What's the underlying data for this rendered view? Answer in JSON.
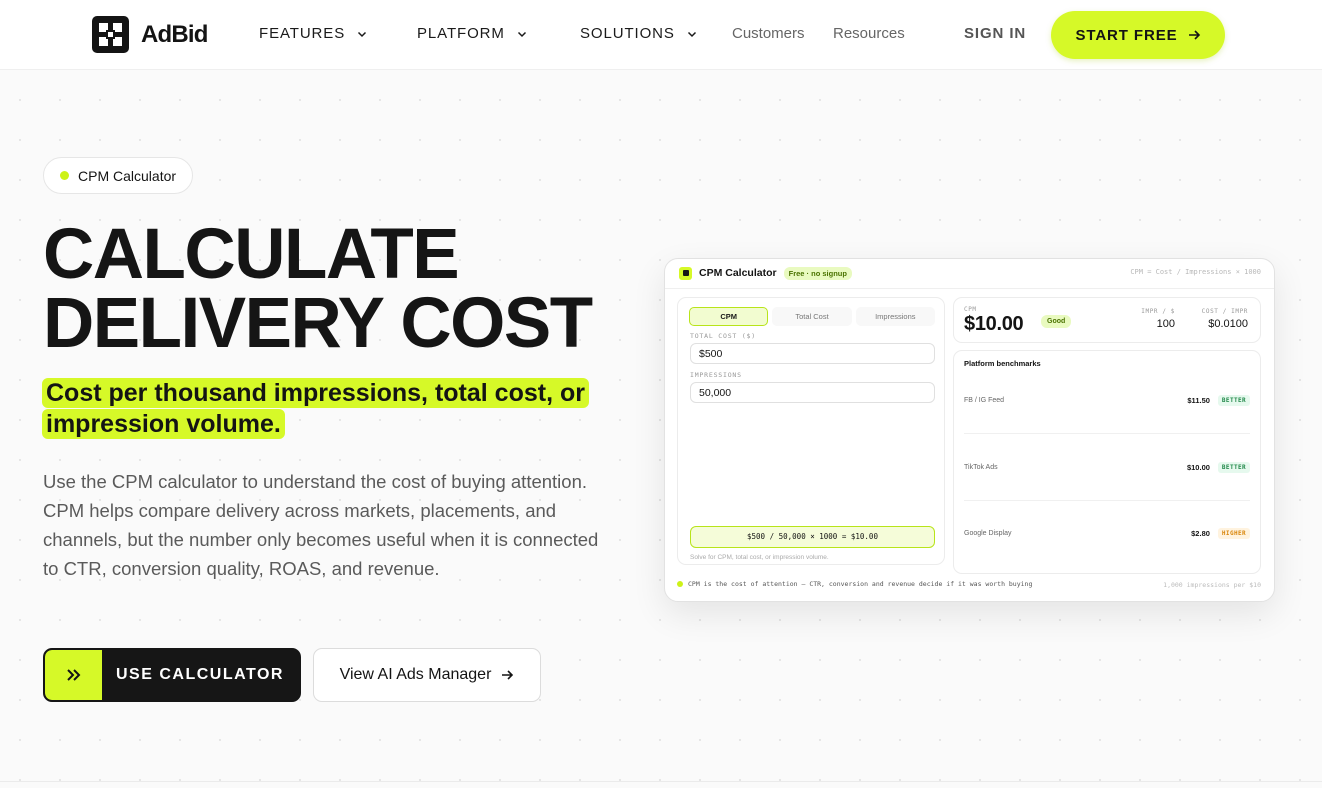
{
  "nav": {
    "brand": "AdBid",
    "items": [
      {
        "label": "FEATURES",
        "dropdown": true
      },
      {
        "label": "PLATFORM",
        "dropdown": true
      },
      {
        "label": "SOLUTIONS",
        "dropdown": true
      },
      {
        "label": "Customers",
        "dropdown": false
      },
      {
        "label": "Resources",
        "dropdown": false
      }
    ],
    "sign_in": "SIGN IN",
    "cta": "START FREE"
  },
  "hero": {
    "pill": "CPM Calculator",
    "title_line1": "CALCULATE",
    "title_line2": "DELIVERY COST",
    "highlight_line1": "Cost per thousand impressions, total cost, or",
    "highlight_line2": "impression volume.",
    "description": "Use the CPM calculator to understand the cost of buying attention. CPM helps compare delivery across markets, placements, and channels, but the number only becomes useful when it is connected to CTR, conversion quality, ROAS, and revenue.",
    "primary_cta": "USE CALCULATOR",
    "secondary_cta": "View AI Ads Manager"
  },
  "calculator": {
    "title": "CPM Calculator",
    "badge": "Free · no signup",
    "formula_header": "CPM = Cost / Impressions × 1000",
    "tabs": [
      "CPM",
      "Total Cost",
      "Impressions"
    ],
    "active_tab": "CPM",
    "total_cost_label": "TOTAL COST ($)",
    "total_cost_value": "$500",
    "impressions_label": "IMPRESSIONS",
    "impressions_value": "50,000",
    "result_formula": "$500 / 50,000 × 1000 = $10.00",
    "solve_note": "Solve for CPM, total cost, or impression volume.",
    "cpm_label": "CPM",
    "cpm_value": "$10.00",
    "cpm_badge": "Good",
    "impr_per_dollar_label": "IMPR / $",
    "impr_per_dollar_value": "100",
    "cost_per_impr_label": "COST / IMPR",
    "cost_per_impr_value": "$0.0100",
    "benchmarks_title": "Platform benchmarks",
    "benchmarks": [
      {
        "name": "FB / IG Feed",
        "price": "$11.50",
        "tag": "BETTER"
      },
      {
        "name": "TikTok Ads",
        "price": "$10.00",
        "tag": "BETTER"
      },
      {
        "name": "Google Display",
        "price": "$2.80",
        "tag": "HIGHER"
      }
    ],
    "footer_note": "CPM is the cost of attention — CTR, conversion and revenue decide if it was worth buying",
    "footer_right": "1,000 impressions per $10"
  },
  "colors": {
    "accent": "#d6f928",
    "dark": "#161616",
    "better": "#22894a",
    "higher": "#d9860b"
  }
}
